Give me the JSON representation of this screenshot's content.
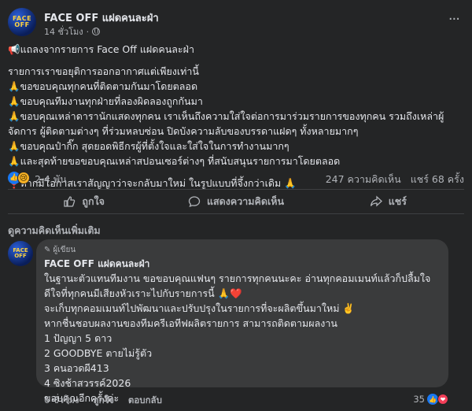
{
  "post": {
    "page_name": "FACE OFF แฝดคนละฝ่า",
    "time": "14 ชั่วโมง",
    "avatar_text": "FACE OFF",
    "lines": [
      "📢แถลงจากรายการ Face Off แฝดคนละฝ่า",
      "",
      "รายการเราขอยุติการออกอากาศแต่เพียงเท่านี้",
      "🙏ขอขอบคุณทุกคนที่ติดตามกันมาโดยตลอด",
      "🙏ขอบคุณทีมงานทุกฝ่ายที่ลองผิดลองถูกกันมา",
      "🙏ขอบคุณเหล่าดารานักแสดงทุกคน เราเห็นถึงความใส่ใจต่อการมาร่วมรายการของทุกคน รวมถึงเหล่าผู้จัดการ ผู้ติดตามต่างๆ ที่ร่วมหลบซ่อน ปิดบังความลับของบรรดาแฝดๆ ทั้งหลายมากๆ",
      "🙏ขอบคุณป๋ากิ๊ก สุดยอดพิธีกรผู้ที่ตั้งใจและใส่ใจในการทำงานมากๆ",
      "🙏และสุดท้ายขอขอบคุณเหล่าสปอนเซอร์ต่างๆ ที่สนับสนุนรายการมาโดยตลอด",
      "",
      "❣️หากมีโอกาสเราสัญญาว่าจะกลับมาใหม่ ในรูปแบบที่จึ้งกว่าเดิม 🙏"
    ]
  },
  "reactions": {
    "count": "2.4 พัน",
    "comments": "247 ความคิดเห็น",
    "shares": "แชร์ 68 ครั้ง"
  },
  "actions": {
    "like": "ถูกใจ",
    "comment": "แสดงความคิดเห็น",
    "share": "แชร์"
  },
  "more_comments": "ดูความคิดเห็นเพิ่มเติม",
  "comment": {
    "badge": "ผู้เขียน",
    "author": "FACE OFF แฝดคนละฝ่า",
    "lines": [
      "ในฐานะตัวแทนทีมงาน ขอขอบคุณแฟนๆ รายการทุกคนนะคะ อ่านทุกคอมเมนท์แล้วก็ปลื้มใจ ดีใจที่ทุกคนมีเสียงหัวเราะไปกับรายการนี้ 🙏❤️",
      "จะเก็บทุกคอมเมนท์ไปพัฒนาและปรับปรุงในรายการที่จะผลิตขึ้นมาใหม่ ✌️",
      "หากชื่นชอบผลงานของทีมครีเอทีฟผลิตรายการ สามารถติดตามผลงาน",
      "1 ปัญญา 5 ดาว",
      "2 GOODBYE ตายไม่รู้ตัว",
      "3 คนอวดผี413",
      "4 ซิงช้าสวรรค์2026",
      "ขอบคุณอีกครั้งค่ะ"
    ],
    "time": "6 ชั่วโมง",
    "like": "ถูกใจ",
    "reply": "ตอบกลับ",
    "reaction_count": "35"
  },
  "colors": {
    "background": "#242526",
    "bubble": "#3a3b3c",
    "accent": "#1877f2"
  },
  "icons": [
    "globe-icon",
    "more-icon",
    "like-icon",
    "comment-icon",
    "share-icon",
    "love-icon",
    "sad-icon"
  ]
}
